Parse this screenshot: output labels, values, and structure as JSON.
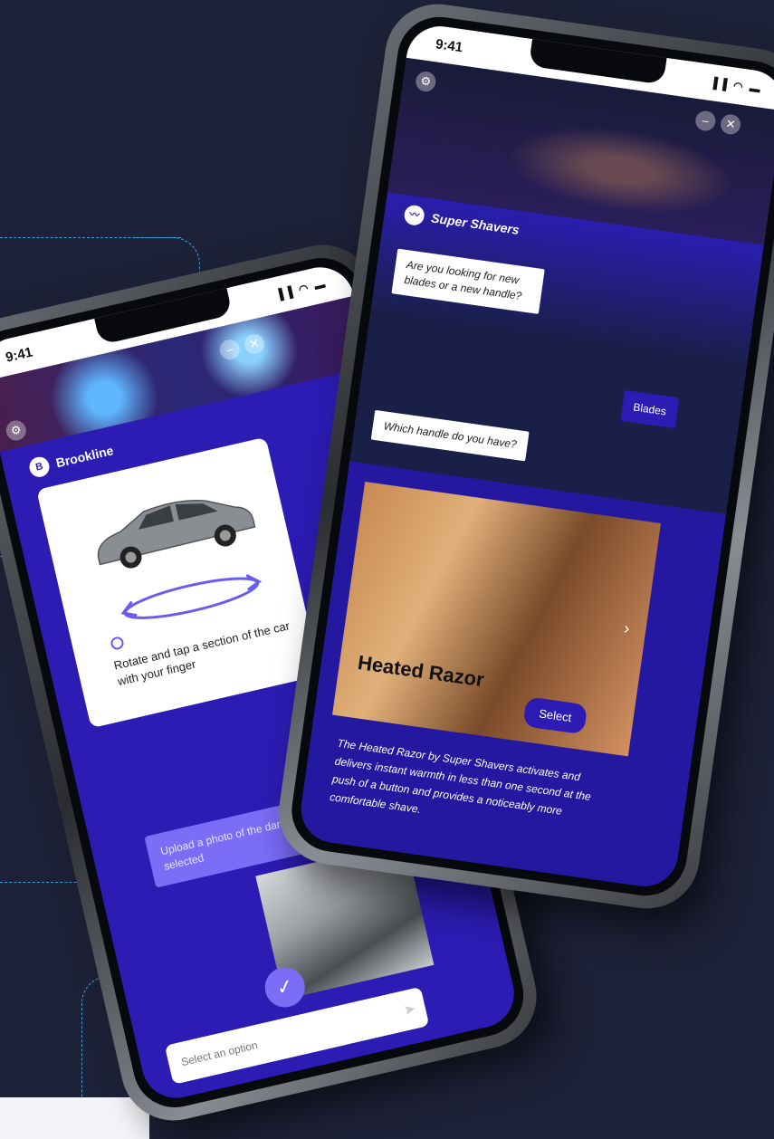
{
  "left_phone": {
    "status_time": "9:41",
    "status_icons": "▐▐ ◠ ▬",
    "brand_name": "Brookline",
    "brand_logo_text": "B",
    "card_text": "Rotate and tap a section of the car with your finger",
    "upload_prompt": "Upload a photo of the damaged areas you selected",
    "option_placeholder": "Select an option"
  },
  "right_phone": {
    "status_time": "9:41",
    "status_icons": "▐▐ ◠ ▬",
    "brand_name": "Super Shavers",
    "bot_question_1": "Are you looking for new blades or a new handle?",
    "user_reply": "Blades",
    "bot_question_2": "Which handle do you have?",
    "product_title": "Heated Razor",
    "select_label": "Select",
    "product_description": "The Heated Razor by Super Shavers activates and delivers instant warmth in less than one second at the push of a button and provides a noticeably more comfortable shave."
  },
  "colors": {
    "background": "#1e2238",
    "brand_purple": "#2c1cb4",
    "accent_lavender": "#7b6df6",
    "dash_line": "#3fa0d8"
  },
  "icons": {
    "close": "close-icon",
    "minimize": "minimize-icon",
    "settings": "settings-icon",
    "check": "check-icon",
    "send": "send-icon",
    "next": "chevron-right-icon"
  }
}
